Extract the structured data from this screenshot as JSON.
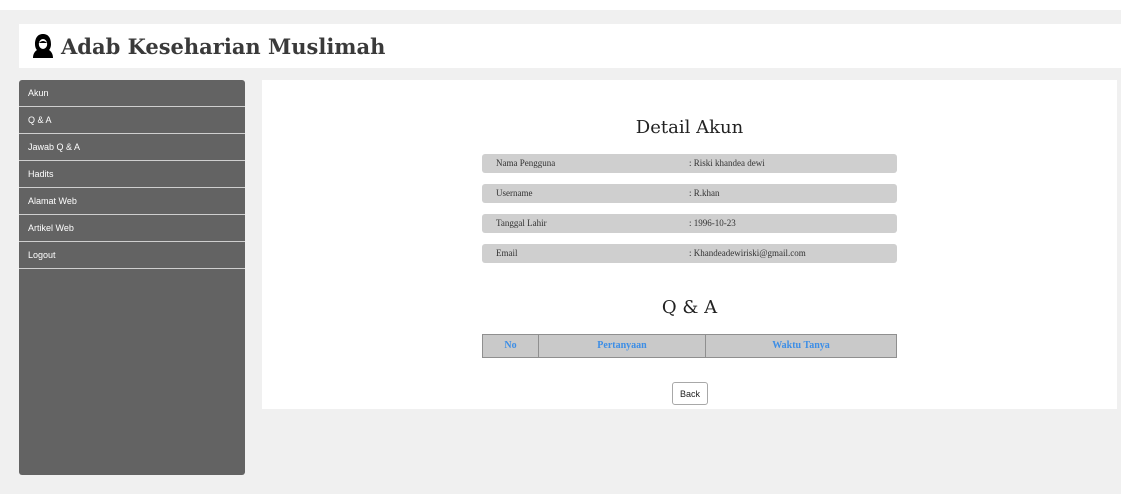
{
  "header": {
    "title": "Adab Keseharian Muslimah",
    "icon": "hijab-woman-icon"
  },
  "sidebar": {
    "items": [
      {
        "label": "Akun"
      },
      {
        "label": "Q & A"
      },
      {
        "label": "Jawab Q & A"
      },
      {
        "label": "Hadits"
      },
      {
        "label": "Alamat Web"
      },
      {
        "label": "Artikel Web"
      },
      {
        "label": "Logout"
      }
    ]
  },
  "detail": {
    "title": "Detail Akun",
    "rows": [
      {
        "label": "Nama Pengguna",
        "value": ": Riski khandea dewi"
      },
      {
        "label": "Username",
        "value": ": R.khan"
      },
      {
        "label": "Tanggal Lahir",
        "value": ": 1996-10-23"
      },
      {
        "label": "Email",
        "value": ": Khandeadewiriski@gmail.com"
      }
    ]
  },
  "qa": {
    "title": "Q & A",
    "columns": [
      "No",
      "Pertanyaan",
      "Waktu Tanya"
    ]
  },
  "back_label": "Back",
  "colors": {
    "sidebar_bg": "#636363",
    "row_bg": "#cfcfcf",
    "table_header_text": "#3d8ee6",
    "page_bg": "#f0f0f0"
  }
}
